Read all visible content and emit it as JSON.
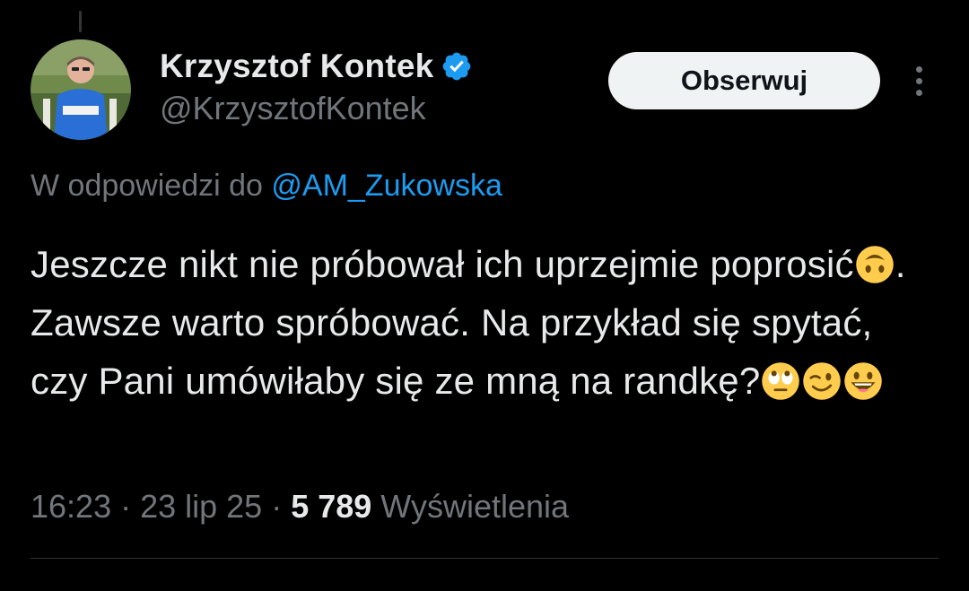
{
  "author": {
    "display_name": "Krzysztof Kontek",
    "handle": "@KrzysztofKontek",
    "verified": true
  },
  "actions": {
    "follow_label": "Obserwuj",
    "more_icon": "more-vertical-icon"
  },
  "reply": {
    "prefix": "W odpowiedzi do ",
    "mention": "@AM_Zukowska"
  },
  "tweet": {
    "part1": "Jeszcze nikt nie próbował ich uprzejmie poprosić",
    "emoji1": "upside-down-face-emoji",
    "part2": ". Zawsze warto spróbować. Na przykład się spytać, czy Pani umówiłaby się ze mną na randkę?",
    "emoji2": "face-with-rolling-eyes-emoji",
    "emoji3": "winking-face-emoji",
    "emoji4": "grinning-face-emoji"
  },
  "meta": {
    "time": "16:23",
    "sep1": " · ",
    "date": "23 lip 25",
    "sep2": " · ",
    "views_count": "5 789",
    "views_label": " Wyświetlenia"
  },
  "colors": {
    "background": "#000000",
    "text": "#e7e9ea",
    "muted": "#71767b",
    "accent": "#1d9bf0",
    "button_bg": "#eff3f4"
  }
}
